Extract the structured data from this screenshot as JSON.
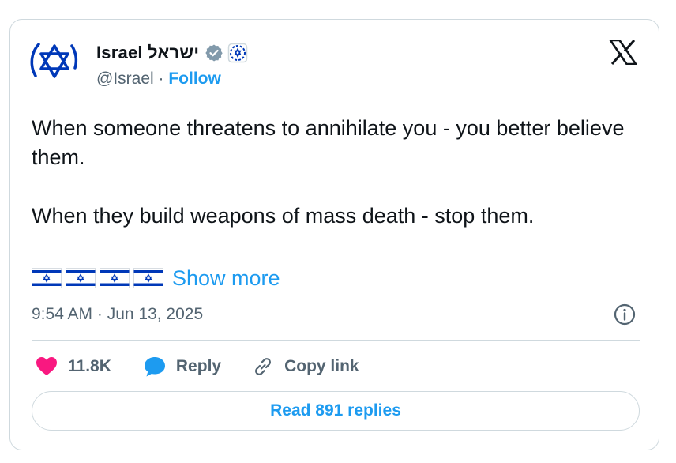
{
  "author": {
    "display_name": "Israel ישראל",
    "handle": "@Israel",
    "separator": " · ",
    "follow_label": "Follow"
  },
  "tweet": {
    "lines": [
      "When someone threatens to annihilate you - you better believe them.",
      "When they build weapons of mass death - stop them."
    ],
    "flag_count": 4,
    "show_more_label": "Show more",
    "timestamp": "9:54 AM · Jun 13, 2025"
  },
  "actions": {
    "likes": "11.8K",
    "reply_label": "Reply",
    "copy_link_label": "Copy link"
  },
  "read_replies_label": "Read 891 replies",
  "colors": {
    "accent": "#1d9bf0",
    "text": "#0f1419",
    "muted": "#536471",
    "heart": "#f91880",
    "border": "#cfd9de",
    "flag_blue": "#0038b8"
  },
  "icons": [
    "star-of-david-avatar-icon",
    "verified-badge-icon",
    "affiliation-badge-icon",
    "x-logo-icon",
    "israel-flag-icon",
    "info-icon",
    "heart-icon",
    "reply-bubble-icon",
    "link-icon"
  ]
}
